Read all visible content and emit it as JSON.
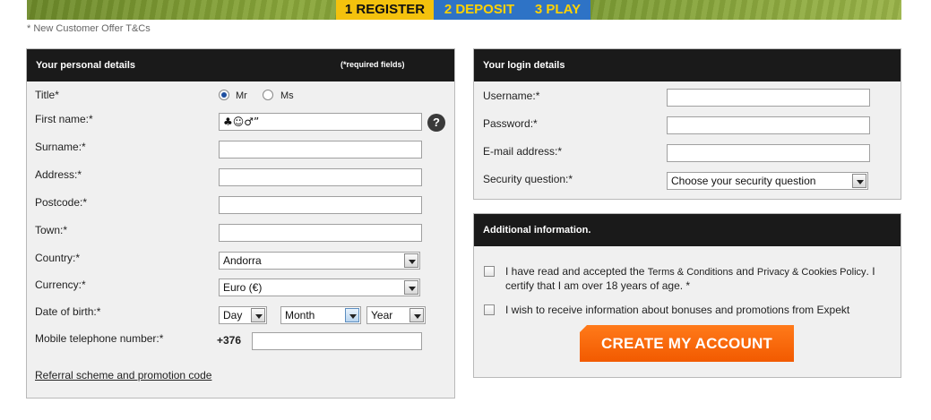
{
  "steps": {
    "register": "1 REGISTER",
    "deposit": "2 DEPOSIT",
    "play": "3 PLAY"
  },
  "offer_text": "* New Customer Offer T&Cs",
  "personal": {
    "header": "Your personal details",
    "required_note": "(*required fields)",
    "title_label": "Title*",
    "title_options": [
      "Mr",
      "Ms"
    ],
    "title_selected": "Mr",
    "first_name_label": "First name:*",
    "first_name_value": "♣☺♂”",
    "help_icon": "question-mark-icon",
    "surname_label": "Surname:*",
    "address_label": "Address:*",
    "postcode_label": "Postcode:*",
    "town_label": "Town:*",
    "country_label": "Country:*",
    "country_value": "Andorra",
    "currency_label": "Currency:*",
    "currency_value": "Euro (€)",
    "dob_label": "Date of birth:*",
    "dob_day": "Day",
    "dob_month": "Month",
    "dob_year": "Year",
    "mobile_label": "Mobile telephone number:*",
    "mobile_prefix": "+376",
    "referral_link": "Referral scheme and promotion code"
  },
  "login": {
    "header": "Your login details",
    "username_label": "Username:*",
    "password_label": "Password:*",
    "email_label": "E-mail address:*",
    "security_label": "Security question:*",
    "security_value": "Choose your security question"
  },
  "additional": {
    "header": "Additional information.",
    "terms_pre": "I have read and accepted the ",
    "terms_link": "Terms & Conditions",
    "terms_and": " and ",
    "privacy_link": "Privacy & Cookies Policy",
    "terms_post": ". I certify that I am over 18 years of age. *",
    "promo_text": "I wish to receive information about bonuses and promotions from Expekt",
    "create_button": "CREATE MY ACCOUNT"
  },
  "colors": {
    "step_active": "#f4c20d",
    "step_inactive": "#2e73c6",
    "step_text": "#ffd200",
    "panel_header": "#1a1a1a",
    "cta": "#f25a00"
  }
}
